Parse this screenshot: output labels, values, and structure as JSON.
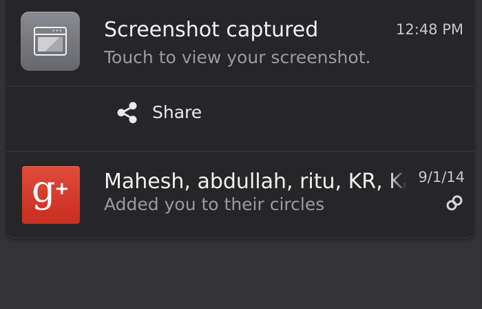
{
  "notifications": [
    {
      "app_icon": "screenshot-app-icon",
      "title": "Screenshot captured",
      "text": "Touch to view your screenshot.",
      "time": "12:48 PM",
      "action": {
        "icon": "share-icon",
        "label": "Share"
      }
    },
    {
      "app_icon": "google-plus-icon",
      "title": "Mahesh, abdullah, ritu, KR, Ka",
      "text": "Added you to their circles",
      "time": "9/1/14",
      "status_icon": "link-icon"
    }
  ],
  "colors": {
    "panel_background": "#262629",
    "google_plus_red": "#d13d2d",
    "primary_text": "#f1f1f1",
    "secondary_text": "#9b9b9f"
  }
}
